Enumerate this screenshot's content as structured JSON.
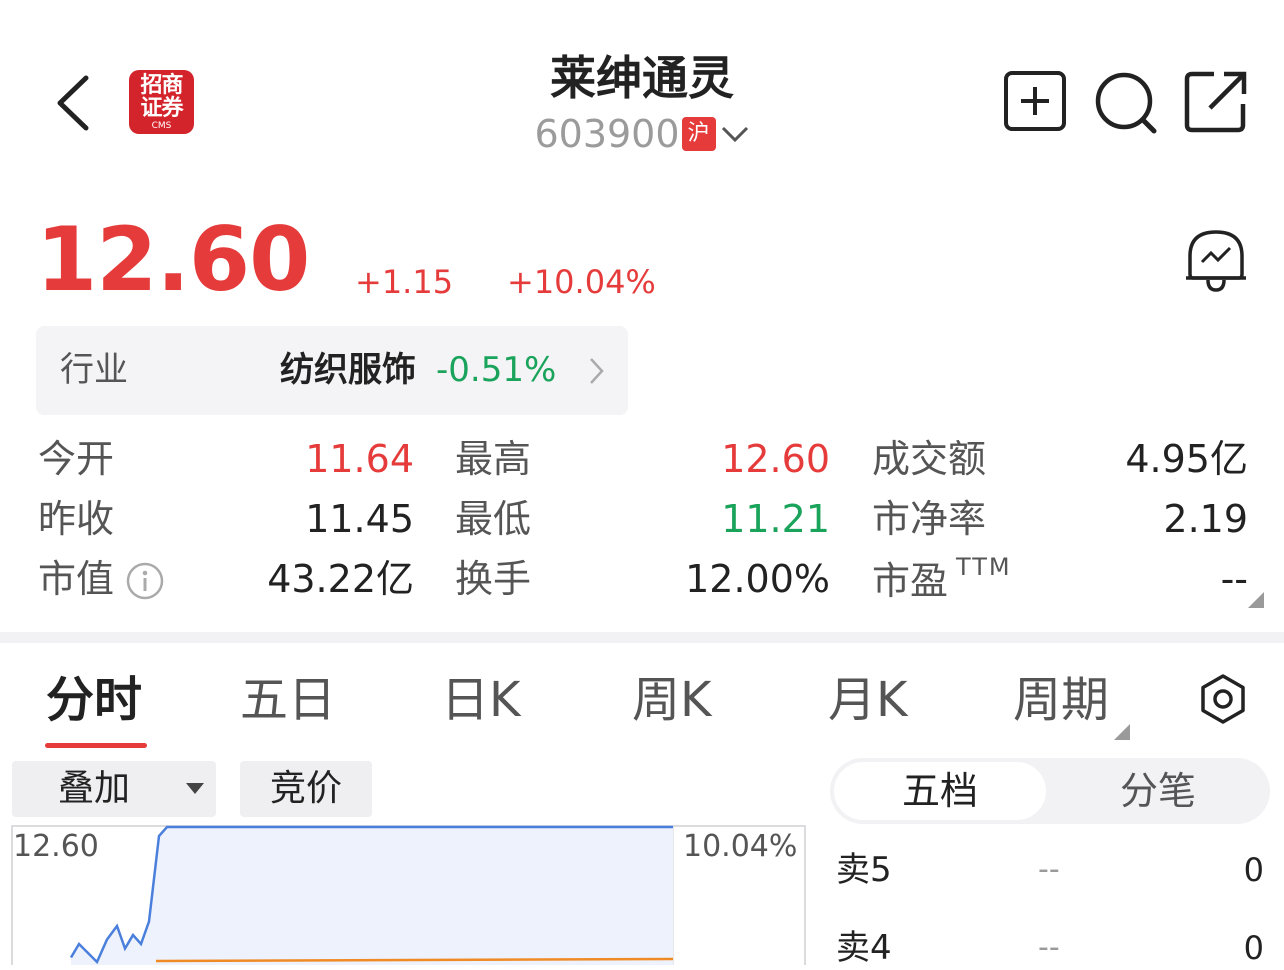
{
  "header": {
    "back_icon": "chevron-left-icon",
    "broker_logo": {
      "line1": "招商",
      "line2": "证券",
      "line3": "CMS",
      "color": "#d4242b"
    },
    "stock_name": "莱绅通灵",
    "stock_code": "603900",
    "market_badge": "沪",
    "icons": [
      "add-watchlist-icon",
      "search-icon",
      "share-icon"
    ]
  },
  "quote": {
    "price": "12.60",
    "change": "+1.15",
    "change_pct": "+10.04%",
    "up_color": "#e63b3b",
    "down_color": "#1aa35a"
  },
  "industry": {
    "label": "行业",
    "name": "纺织服饰",
    "change": "-0.51%"
  },
  "stats": {
    "open_label": "今开",
    "open_value": "11.64",
    "high_label": "最高",
    "high_value": "12.60",
    "turnover_label": "成交额",
    "turnover_value": "4.95亿",
    "prev_close_label": "昨收",
    "prev_close_value": "11.45",
    "low_label": "最低",
    "low_value": "11.21",
    "pb_label": "市净率",
    "pb_value": "2.19",
    "mkt_cap_label": "市值",
    "mkt_cap_value": "43.22亿",
    "turnover_rate_label": "换手",
    "turnover_rate_value": "12.00%",
    "pe_label": "市盈",
    "pe_sup": "TTM",
    "pe_value": "--"
  },
  "tabs": [
    {
      "label": "分时",
      "active": true
    },
    {
      "label": "五日",
      "active": false
    },
    {
      "label": "日K",
      "active": false
    },
    {
      "label": "周K",
      "active": false
    },
    {
      "label": "月K",
      "active": false
    },
    {
      "label": "周期",
      "active": false
    }
  ],
  "chart_controls": {
    "overlay_label": "叠加",
    "auction_label": "竞价",
    "segment": [
      "五档",
      "分笔"
    ],
    "segment_active": 0
  },
  "chart_data": {
    "type": "line",
    "title": "",
    "price_top_label": "12.60",
    "pct_top_label": "10.04%",
    "series": [
      {
        "color": "#4a7fdc",
        "values": [
          11.15,
          11.3,
          11.2,
          11.1,
          11.35,
          11.5,
          11.25,
          11.4,
          11.3,
          11.55,
          12.5,
          12.6,
          12.6,
          12.6,
          12.6,
          12.6,
          12.6,
          12.6,
          12.6,
          12.6
        ]
      },
      {
        "color": "#f08a24",
        "values": []
      }
    ],
    "ylim_top": 12.6
  },
  "order_book": [
    {
      "label": "卖5",
      "price": "--",
      "volume": "0"
    },
    {
      "label": "卖4",
      "price": "--",
      "volume": "0"
    }
  ]
}
